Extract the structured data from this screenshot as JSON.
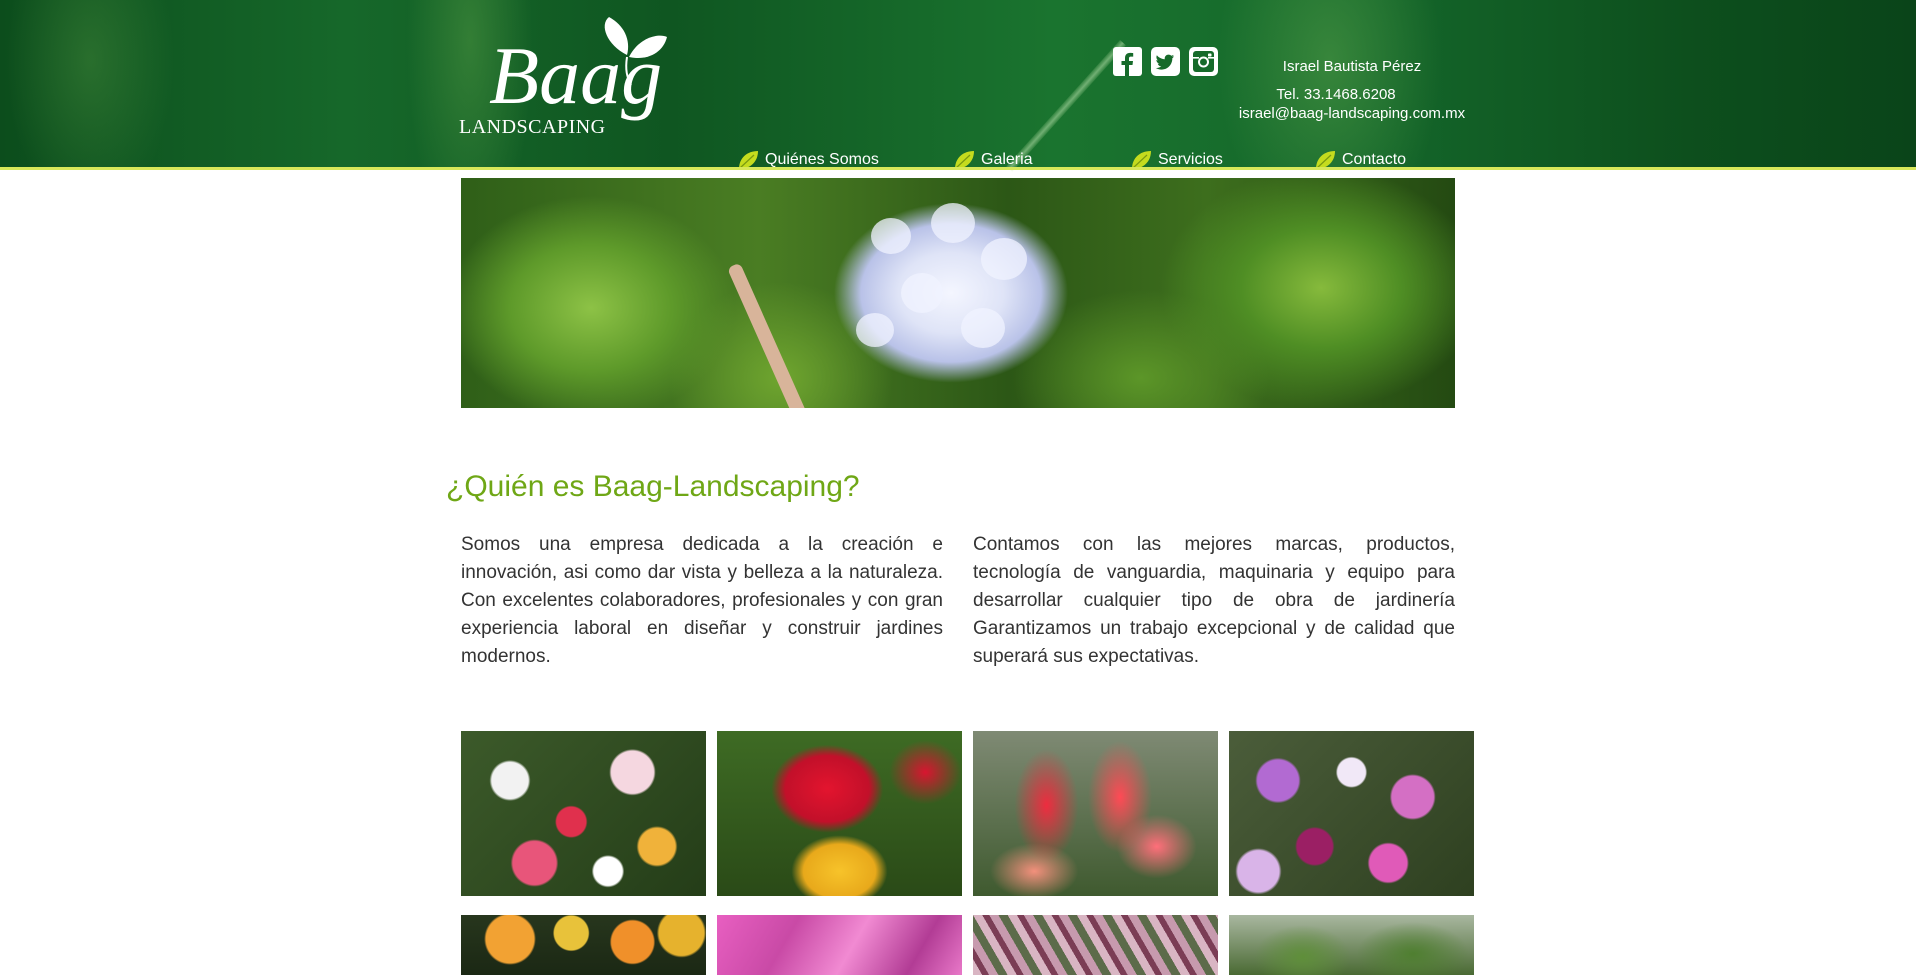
{
  "brand": {
    "logo_script": "Baag",
    "logo_caption": "LANDSCAPING",
    "accent_green": "#6fa716",
    "nav_leaf_color": "#c5dc1e"
  },
  "social": [
    {
      "name": "facebook-icon"
    },
    {
      "name": "twitter-icon"
    },
    {
      "name": "instagram-icon"
    }
  ],
  "contact": {
    "name": "Israel Bautista Pérez",
    "phone": "Tel. 33.1468.6208",
    "email": "israel@baag-landscaping.com.mx"
  },
  "nav": [
    {
      "label": "Quiénes Somos"
    },
    {
      "label": "Galeria"
    },
    {
      "label": "Servicios"
    },
    {
      "label": "Contacto"
    }
  ],
  "about": {
    "title": "¿Quién es Baag-Landscaping?",
    "paragraph_left": "Somos una empresa dedicada a la creación e innovación, asi como dar vista y belleza a la naturaleza. Con excelentes colaboradores, profesionales y con gran experiencia laboral en diseñar y construir jardines modernos.",
    "paragraph_right": "Contamos con las mejores marcas, productos, tecnología de vanguardia, maquinaria y equipo para desarrollar cualquier tipo de obra de jardinería Garantizamos un trabajo excepcional y de calidad que superará sus expectativas."
  },
  "gallery": {
    "row1": [
      {
        "name": "gallery-photo-kalanchoe-mix"
      },
      {
        "name": "gallery-photo-red-yellow-celosia"
      },
      {
        "name": "gallery-photo-red-salvia"
      },
      {
        "name": "gallery-photo-petunias"
      }
    ],
    "row2": [
      {
        "name": "gallery-photo-marigolds"
      },
      {
        "name": "gallery-photo-pink-foliage"
      },
      {
        "name": "gallery-photo-pink-striped-leaves"
      },
      {
        "name": "gallery-photo-shrubs"
      }
    ]
  }
}
